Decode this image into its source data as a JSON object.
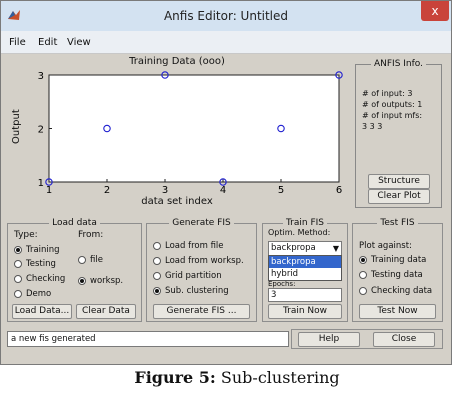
{
  "window": {
    "title": "Anfis Editor: Untitled",
    "close_glyph": "x",
    "icon": "matlab-icon"
  },
  "menu": [
    "File",
    "Edit",
    "View"
  ],
  "chart_data": {
    "type": "scatter",
    "title": "Training Data (ooo)",
    "xlabel": "data set index",
    "ylabel": "Output",
    "x": [
      1,
      2,
      3,
      4,
      5,
      6
    ],
    "y": [
      1,
      2,
      3,
      1,
      2,
      3
    ],
    "xlim": [
      1,
      6
    ],
    "ylim": [
      1,
      3
    ],
    "xticks": [
      "1",
      "2",
      "3",
      "4",
      "5",
      "6"
    ],
    "yticks": [
      "1",
      "2",
      "3"
    ],
    "marker": "circle-open",
    "marker_color": "#1f1fd0",
    "grid": false
  },
  "info_panel": {
    "title": "ANFIS Info.",
    "lines": [
      "# of input: 3",
      "# of outputs: 1",
      "# of input mfs:",
      "3  3  3"
    ],
    "structure_button": "Structure",
    "clear_plot_button": "Clear Plot"
  },
  "load_data": {
    "title": "Load data",
    "type_label": "Type:",
    "from_label": "From:",
    "types": [
      {
        "label": "Training",
        "selected": true
      },
      {
        "label": "Testing",
        "selected": false
      },
      {
        "label": "Checking",
        "selected": false
      },
      {
        "label": "Demo",
        "selected": false
      }
    ],
    "sources": [
      {
        "label": "file",
        "selected": false
      },
      {
        "label": "worksp.",
        "selected": true
      }
    ],
    "load_button": "Load Data...",
    "clear_button": "Clear Data"
  },
  "generate_fis": {
    "title": "Generate FIS",
    "options": [
      {
        "label": "Load from file",
        "selected": false
      },
      {
        "label": "Load from worksp.",
        "selected": false
      },
      {
        "label": "Grid partition",
        "selected": false
      },
      {
        "label": "Sub. clustering",
        "selected": true
      }
    ],
    "button": "Generate FIS ..."
  },
  "train_fis": {
    "title": "Train FIS",
    "method_label": "Optim. Method:",
    "method_value": "backpropa",
    "method_options": [
      "backpropa",
      "hybrid"
    ],
    "epochs_label": "Epochs:",
    "epochs_value": "3",
    "button": "Train Now"
  },
  "test_fis": {
    "title": "Test FIS",
    "plot_against_label": "Plot against:",
    "options": [
      {
        "label": "Training data",
        "selected": true
      },
      {
        "label": "Testing data",
        "selected": false
      },
      {
        "label": "Checking data",
        "selected": false
      }
    ],
    "button": "Test Now"
  },
  "status": "a new fis generated",
  "help_button": "Help",
  "close_button": "Close",
  "caption": {
    "bold": "Figure 5:",
    "rest": " Sub-clustering"
  }
}
